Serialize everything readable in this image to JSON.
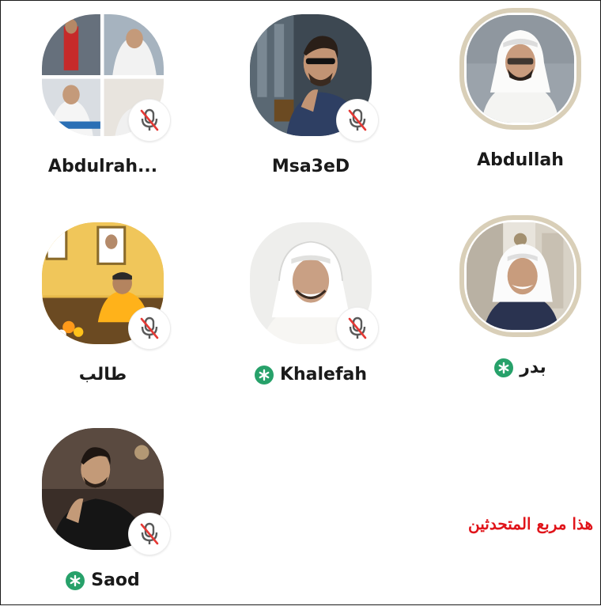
{
  "speakers": [
    {
      "name": "Abdullah",
      "muted": false,
      "new_member": false,
      "ring": true
    },
    {
      "name": "Msa3eD",
      "muted": true,
      "new_member": false,
      "ring": false
    },
    {
      "name": "Abdulrah...",
      "muted": true,
      "new_member": false,
      "ring": false
    },
    {
      "name": "بدر",
      "muted": false,
      "new_member": true,
      "ring": true
    },
    {
      "name": "Khalefah",
      "muted": true,
      "new_member": true,
      "ring": false
    },
    {
      "name": "طالب",
      "muted": true,
      "new_member": false,
      "ring": false
    },
    {
      "name": "Saod",
      "muted": true,
      "new_member": true,
      "ring": false
    }
  ],
  "annotation": "هذا مربع المتحدثين",
  "icons": {
    "mute": "microphone-muted-icon",
    "new_member": "asterisk-badge-icon"
  },
  "colors": {
    "ring": "#d9cfb8",
    "new_member_badge": "#27a16a",
    "mute_slash": "#e53935",
    "annotation": "#e0141a"
  }
}
